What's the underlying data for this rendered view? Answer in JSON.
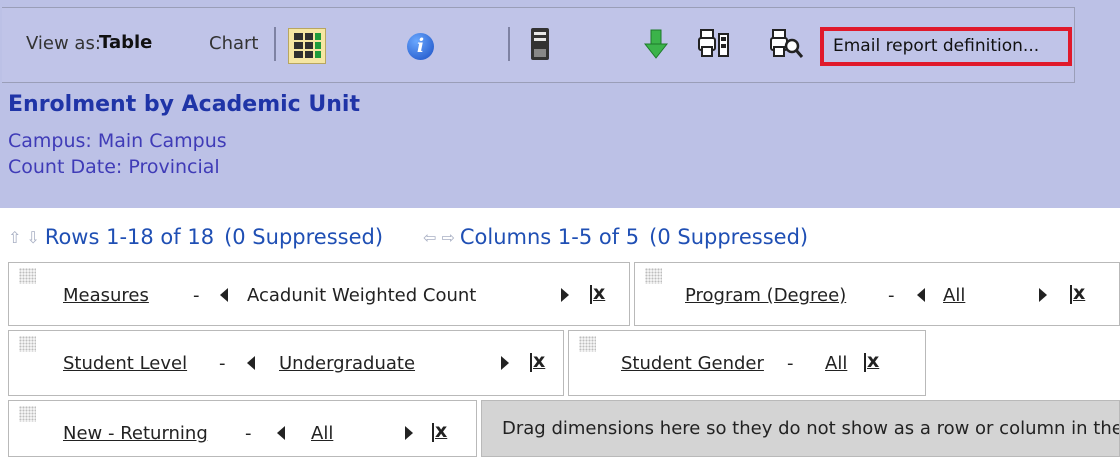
{
  "toolbar": {
    "view_as_label": "View as:",
    "view_table": "Table",
    "view_chart": "Chart",
    "info_glyph": "i",
    "email_label": "Email report definition...",
    "icons": [
      "grid-table-icon",
      "info-icon",
      "save-icon",
      "download-arrow-icon",
      "print-setup-icon",
      "print-preview-icon"
    ],
    "accent_colors": {
      "highlight_border": "#e0192b",
      "title_blue": "#1f34a7",
      "header_bg": "#bcc1e6"
    }
  },
  "report": {
    "title": "Enrolment by Academic Unit",
    "campus": "Campus: Main Campus",
    "count_date": "Count Date: Provincial"
  },
  "navigation": {
    "rows": "Rows 1-18 of 18",
    "rows_suppressed": "(0 Suppressed)",
    "columns": "Columns 1-5 of 5",
    "columns_suppressed": "(0 Suppressed)"
  },
  "dimensions": [
    {
      "name": "Measures",
      "separator": "-",
      "value": "Acadunit Weighted Count",
      "value_link": false
    },
    {
      "name": "Program (Degree)",
      "separator": "-",
      "value": "All",
      "value_link": true
    },
    {
      "name": "Student Level",
      "separator": "-",
      "value": "Undergraduate",
      "value_link": true
    },
    {
      "name": "Student Gender",
      "separator": "-",
      "value": "All",
      "value_link": true
    },
    {
      "name": "New - Returning",
      "separator": "-",
      "value": "All",
      "value_link": true
    }
  ],
  "drop_zone_text": "Drag dimensions here so they do not show as a row or column in the report"
}
